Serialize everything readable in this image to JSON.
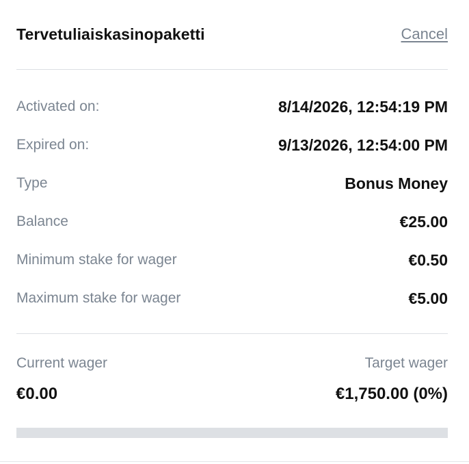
{
  "header": {
    "title": "Tervetuliaiskasinopaketti",
    "cancel_label": "Cancel"
  },
  "details": [
    {
      "label": "Activated on:",
      "value": "8/14/2026, 12:54:19 PM"
    },
    {
      "label": "Expired on:",
      "value": "9/13/2026, 12:54:00 PM"
    },
    {
      "label": "Type",
      "value": "Bonus Money"
    },
    {
      "label": "Balance",
      "value": "€25.00"
    },
    {
      "label": "Minimum stake for wager",
      "value": "€0.50"
    },
    {
      "label": "Maximum stake for wager",
      "value": "€5.00"
    }
  ],
  "wager": {
    "current_label": "Current wager",
    "current_value": "€0.00",
    "target_label": "Target wager",
    "target_value": "€1,750.00 (0%)",
    "progress_percent": 0
  },
  "colors": {
    "label_gray": "#7b8591",
    "value_dark": "#111111",
    "divider": "#dcdfe3",
    "progress_track": "#dde0e4"
  }
}
